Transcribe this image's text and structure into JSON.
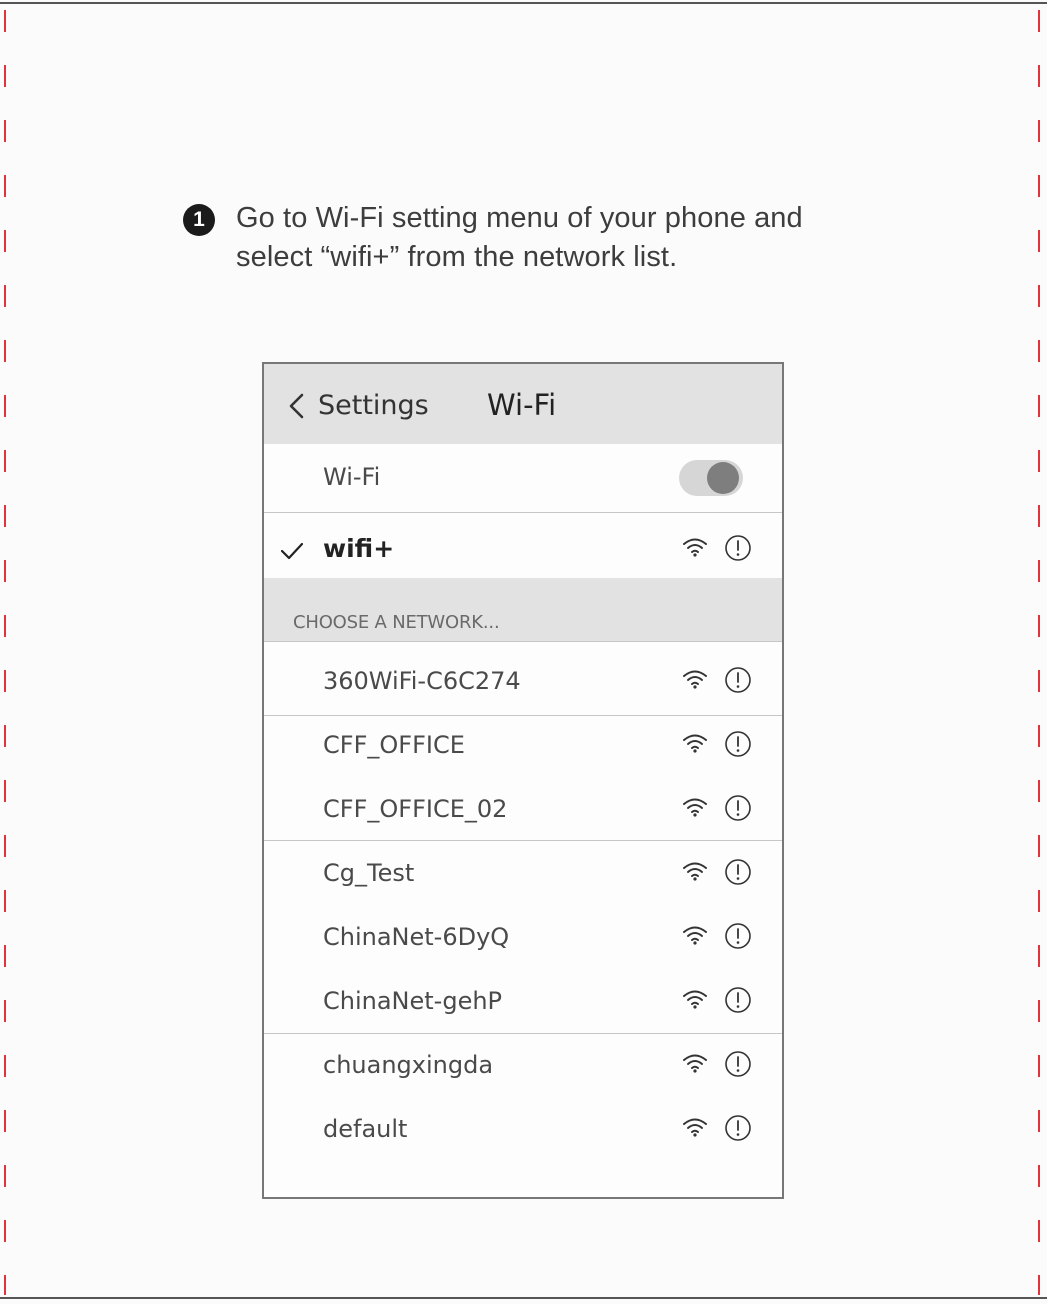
{
  "instruction": {
    "step_number": "1",
    "text_line1": "Go to Wi-Fi setting menu of your phone and",
    "text_line2": "select “wifi+” from the network list."
  },
  "header": {
    "back_label": "Settings",
    "title": "Wi-Fi"
  },
  "wifi_toggle": {
    "label": "Wi-Fi",
    "state": "on"
  },
  "connected": {
    "name": "wifi+"
  },
  "section_label": "CHOOSE A NETWORK...",
  "networks": [
    "360WiFi-C6C274",
    "CFF_OFFICE",
    "CFF_OFFICE_02",
    "Cg_Test",
    "ChinaNet-6DyQ",
    "ChinaNet-gehP",
    "chuangxingda",
    "default"
  ],
  "icons": {
    "back": "chevron-left-icon",
    "check": "checkmark-icon",
    "signal": "wifi-signal-icon",
    "info": "info-icon"
  },
  "colors": {
    "cut_line": "#e0343c",
    "header_bg": "#e2e2e2",
    "toggle_track": "#d6d6d6",
    "toggle_knob": "#7e7e7e"
  }
}
